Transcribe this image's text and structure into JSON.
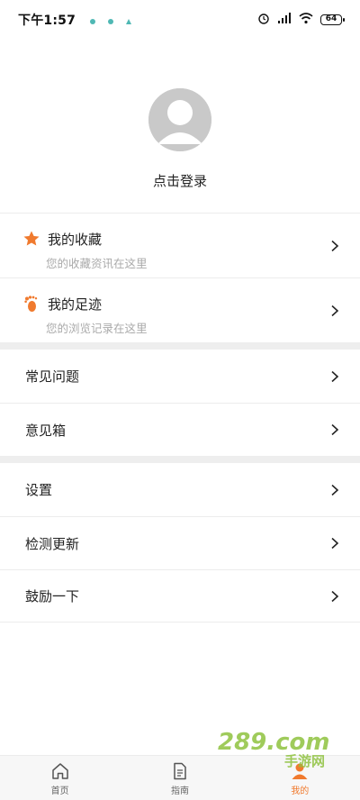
{
  "status_bar": {
    "time": "下午1:57",
    "battery": "64"
  },
  "profile": {
    "login_text": "点击登录"
  },
  "menu": {
    "favorites": {
      "title": "我的收藏",
      "subtitle": "您的收藏资讯在这里",
      "icon": "star-icon"
    },
    "footprints": {
      "title": "我的足迹",
      "subtitle": "您的浏览记录在这里",
      "icon": "footprint-icon"
    },
    "faq": {
      "title": "常见问题"
    },
    "feedback": {
      "title": "意见箱"
    },
    "settings": {
      "title": "设置"
    },
    "check_update": {
      "title": "检测更新"
    },
    "encourage": {
      "title": "鼓励一下"
    }
  },
  "bottom_nav": {
    "items": [
      {
        "label": "首页",
        "icon": "home-icon",
        "active": false
      },
      {
        "label": "指南",
        "icon": "document-icon",
        "active": false
      },
      {
        "label": "我的",
        "icon": "user-icon",
        "active": true
      }
    ]
  },
  "colors": {
    "accent": "#f07a2e",
    "divider": "#ececec",
    "section_gap": "#eeeeee",
    "subtitle": "#aaaaaa"
  },
  "watermark": {
    "text": "289.com",
    "subtext": "手游网"
  }
}
